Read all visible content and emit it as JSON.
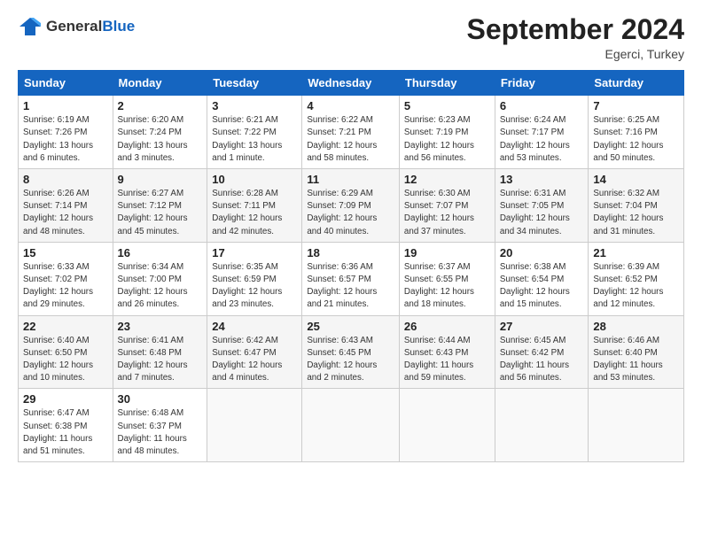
{
  "logo": {
    "general": "General",
    "blue": "Blue"
  },
  "header": {
    "month_year": "September 2024",
    "location": "Egerci, Turkey"
  },
  "days_of_week": [
    "Sunday",
    "Monday",
    "Tuesday",
    "Wednesday",
    "Thursday",
    "Friday",
    "Saturday"
  ],
  "weeks": [
    [
      {
        "day": "1",
        "info": "Sunrise: 6:19 AM\nSunset: 7:26 PM\nDaylight: 13 hours\nand 6 minutes."
      },
      {
        "day": "2",
        "info": "Sunrise: 6:20 AM\nSunset: 7:24 PM\nDaylight: 13 hours\nand 3 minutes."
      },
      {
        "day": "3",
        "info": "Sunrise: 6:21 AM\nSunset: 7:22 PM\nDaylight: 13 hours\nand 1 minute."
      },
      {
        "day": "4",
        "info": "Sunrise: 6:22 AM\nSunset: 7:21 PM\nDaylight: 12 hours\nand 58 minutes."
      },
      {
        "day": "5",
        "info": "Sunrise: 6:23 AM\nSunset: 7:19 PM\nDaylight: 12 hours\nand 56 minutes."
      },
      {
        "day": "6",
        "info": "Sunrise: 6:24 AM\nSunset: 7:17 PM\nDaylight: 12 hours\nand 53 minutes."
      },
      {
        "day": "7",
        "info": "Sunrise: 6:25 AM\nSunset: 7:16 PM\nDaylight: 12 hours\nand 50 minutes."
      }
    ],
    [
      {
        "day": "8",
        "info": "Sunrise: 6:26 AM\nSunset: 7:14 PM\nDaylight: 12 hours\nand 48 minutes."
      },
      {
        "day": "9",
        "info": "Sunrise: 6:27 AM\nSunset: 7:12 PM\nDaylight: 12 hours\nand 45 minutes."
      },
      {
        "day": "10",
        "info": "Sunrise: 6:28 AM\nSunset: 7:11 PM\nDaylight: 12 hours\nand 42 minutes."
      },
      {
        "day": "11",
        "info": "Sunrise: 6:29 AM\nSunset: 7:09 PM\nDaylight: 12 hours\nand 40 minutes."
      },
      {
        "day": "12",
        "info": "Sunrise: 6:30 AM\nSunset: 7:07 PM\nDaylight: 12 hours\nand 37 minutes."
      },
      {
        "day": "13",
        "info": "Sunrise: 6:31 AM\nSunset: 7:05 PM\nDaylight: 12 hours\nand 34 minutes."
      },
      {
        "day": "14",
        "info": "Sunrise: 6:32 AM\nSunset: 7:04 PM\nDaylight: 12 hours\nand 31 minutes."
      }
    ],
    [
      {
        "day": "15",
        "info": "Sunrise: 6:33 AM\nSunset: 7:02 PM\nDaylight: 12 hours\nand 29 minutes."
      },
      {
        "day": "16",
        "info": "Sunrise: 6:34 AM\nSunset: 7:00 PM\nDaylight: 12 hours\nand 26 minutes."
      },
      {
        "day": "17",
        "info": "Sunrise: 6:35 AM\nSunset: 6:59 PM\nDaylight: 12 hours\nand 23 minutes."
      },
      {
        "day": "18",
        "info": "Sunrise: 6:36 AM\nSunset: 6:57 PM\nDaylight: 12 hours\nand 21 minutes."
      },
      {
        "day": "19",
        "info": "Sunrise: 6:37 AM\nSunset: 6:55 PM\nDaylight: 12 hours\nand 18 minutes."
      },
      {
        "day": "20",
        "info": "Sunrise: 6:38 AM\nSunset: 6:54 PM\nDaylight: 12 hours\nand 15 minutes."
      },
      {
        "day": "21",
        "info": "Sunrise: 6:39 AM\nSunset: 6:52 PM\nDaylight: 12 hours\nand 12 minutes."
      }
    ],
    [
      {
        "day": "22",
        "info": "Sunrise: 6:40 AM\nSunset: 6:50 PM\nDaylight: 12 hours\nand 10 minutes."
      },
      {
        "day": "23",
        "info": "Sunrise: 6:41 AM\nSunset: 6:48 PM\nDaylight: 12 hours\nand 7 minutes."
      },
      {
        "day": "24",
        "info": "Sunrise: 6:42 AM\nSunset: 6:47 PM\nDaylight: 12 hours\nand 4 minutes."
      },
      {
        "day": "25",
        "info": "Sunrise: 6:43 AM\nSunset: 6:45 PM\nDaylight: 12 hours\nand 2 minutes."
      },
      {
        "day": "26",
        "info": "Sunrise: 6:44 AM\nSunset: 6:43 PM\nDaylight: 11 hours\nand 59 minutes."
      },
      {
        "day": "27",
        "info": "Sunrise: 6:45 AM\nSunset: 6:42 PM\nDaylight: 11 hours\nand 56 minutes."
      },
      {
        "day": "28",
        "info": "Sunrise: 6:46 AM\nSunset: 6:40 PM\nDaylight: 11 hours\nand 53 minutes."
      }
    ],
    [
      {
        "day": "29",
        "info": "Sunrise: 6:47 AM\nSunset: 6:38 PM\nDaylight: 11 hours\nand 51 minutes."
      },
      {
        "day": "30",
        "info": "Sunrise: 6:48 AM\nSunset: 6:37 PM\nDaylight: 11 hours\nand 48 minutes."
      },
      {
        "day": "",
        "info": ""
      },
      {
        "day": "",
        "info": ""
      },
      {
        "day": "",
        "info": ""
      },
      {
        "day": "",
        "info": ""
      },
      {
        "day": "",
        "info": ""
      }
    ]
  ]
}
